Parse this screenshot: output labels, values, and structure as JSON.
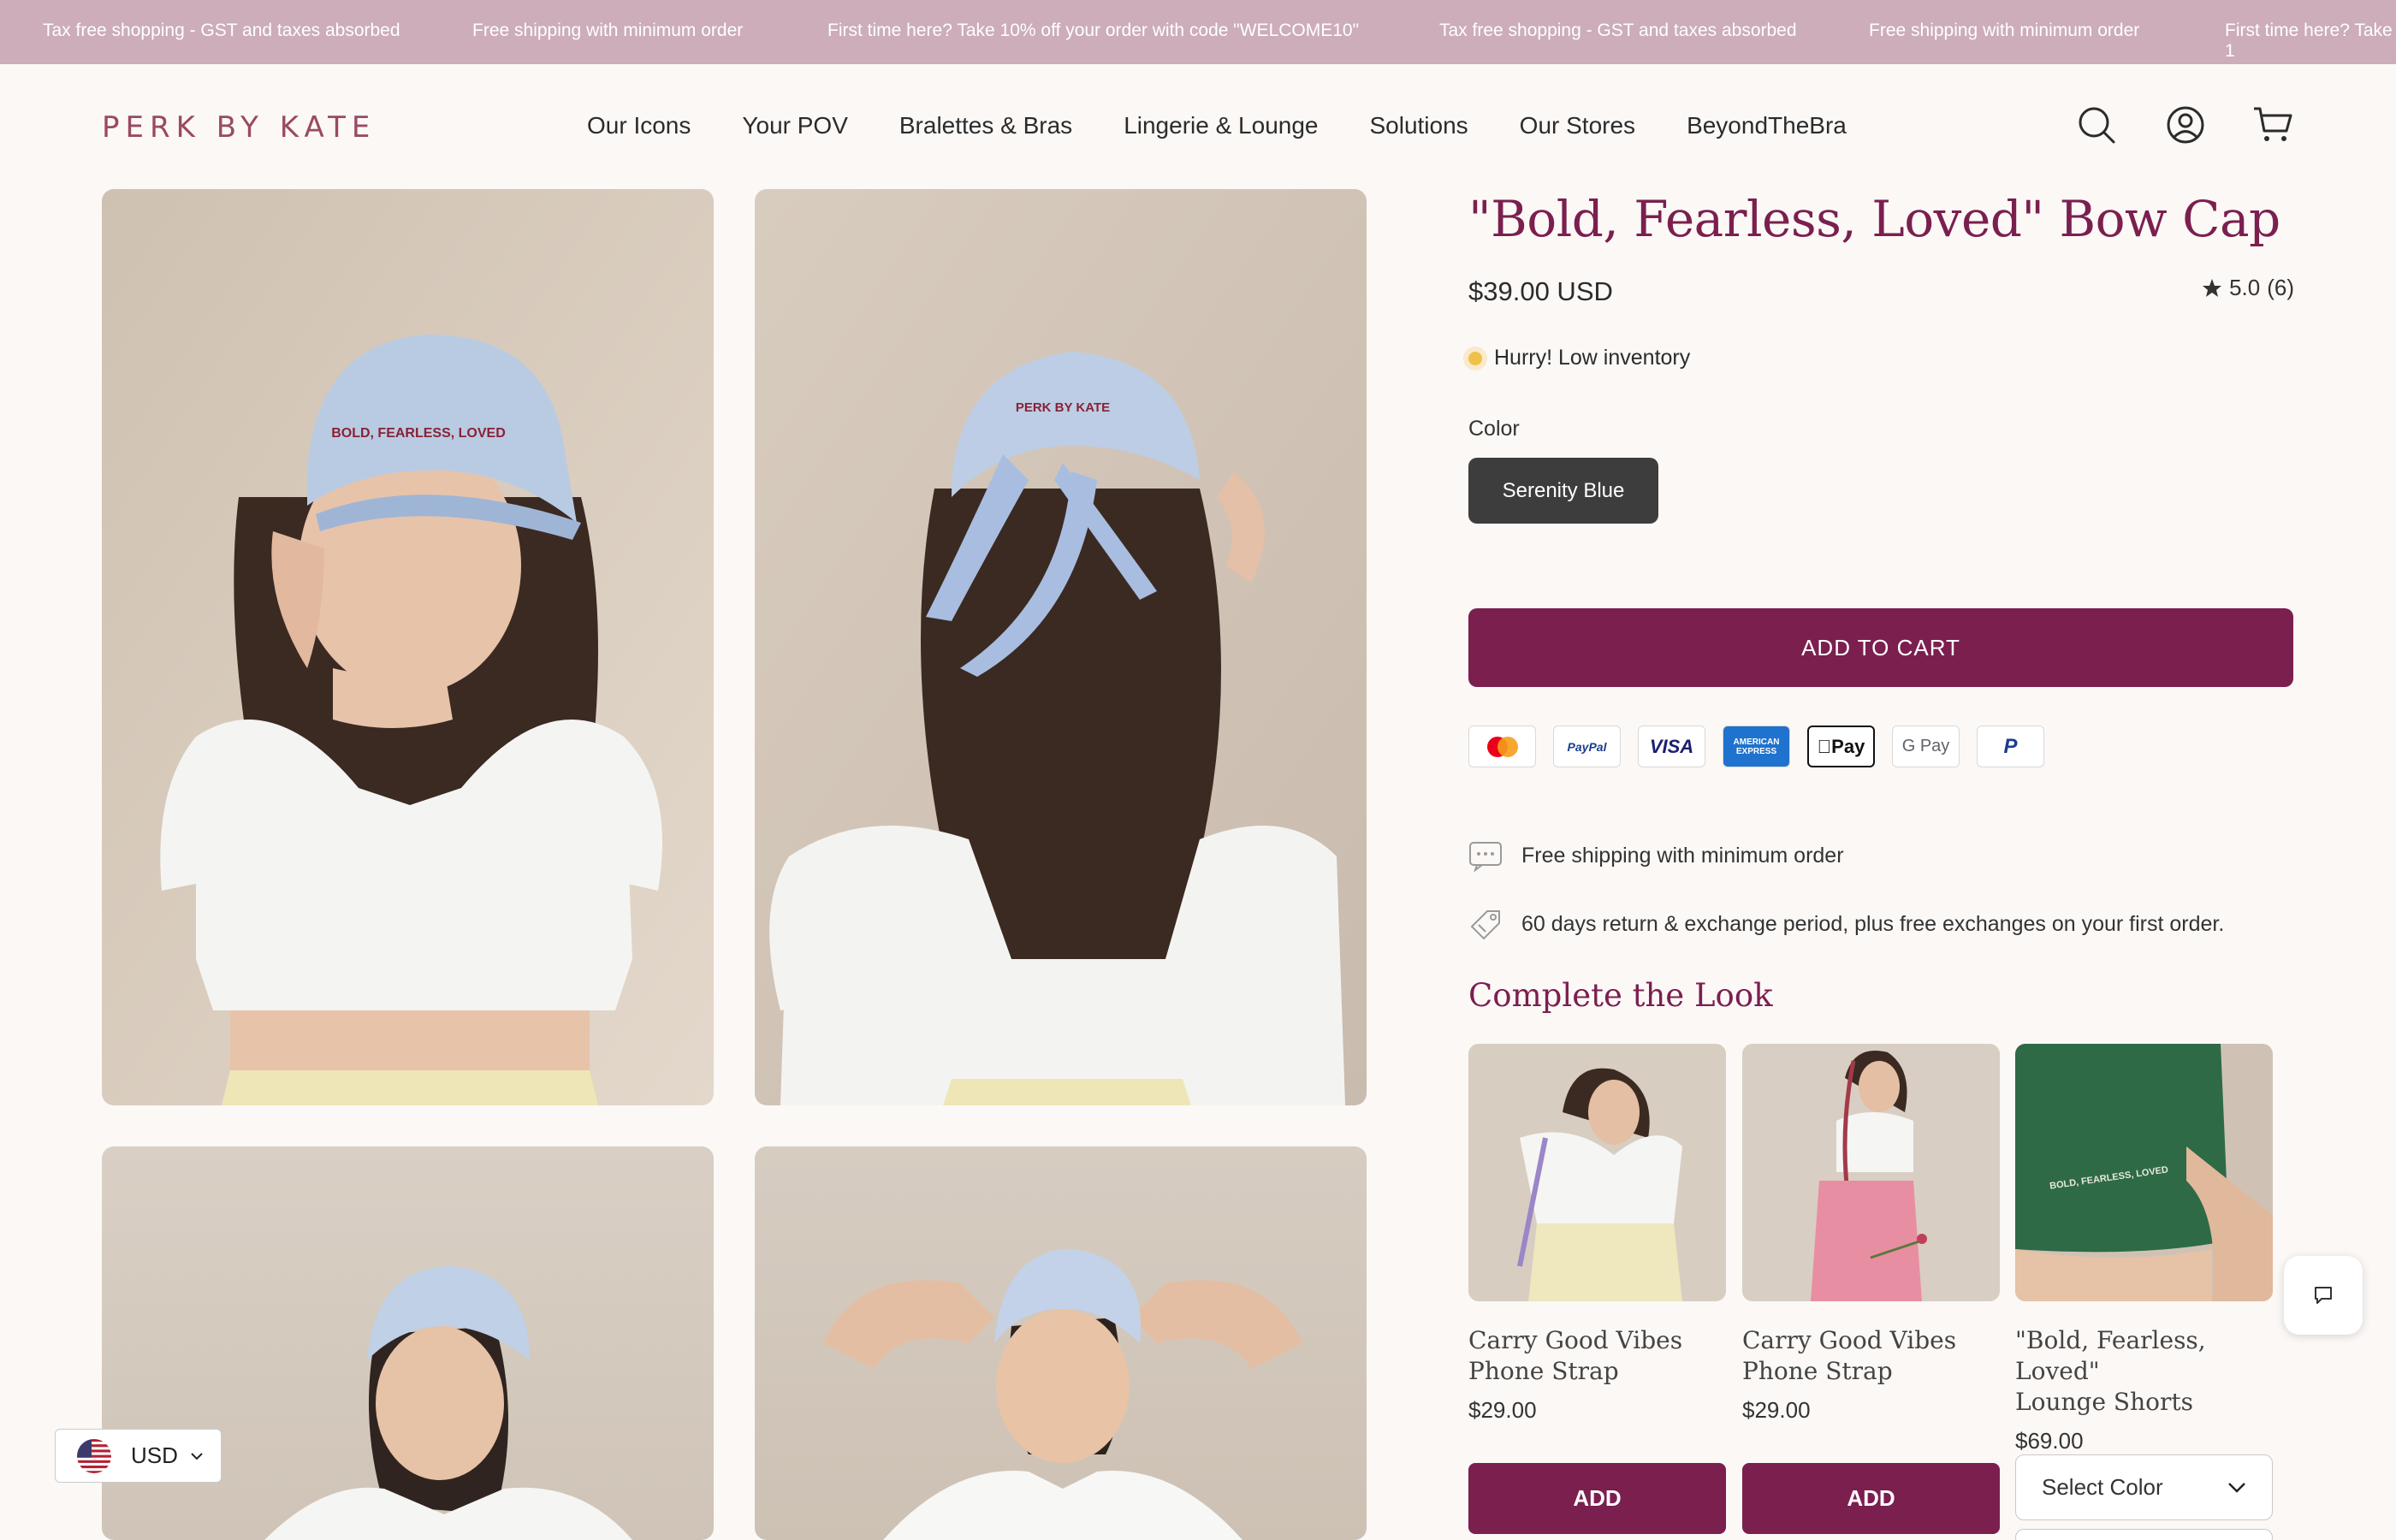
{
  "announcements": [
    "Tax free shopping - GST and taxes absorbed",
    "Free shipping with minimum order",
    "First time here? Take 10% off your order with code \"WELCOME10\"",
    "Tax free shopping - GST and taxes absorbed",
    "Free shipping with minimum order",
    "First time here? Take 1"
  ],
  "header": {
    "logo": "PERK BY KATE",
    "nav": [
      "Our Icons",
      "Your POV",
      "Bralettes & Bras",
      "Lingerie & Lounge",
      "Solutions",
      "Our Stores",
      "BeyondTheBra"
    ],
    "icons": [
      "search-icon",
      "account-icon",
      "cart-icon"
    ]
  },
  "product": {
    "title": "\"Bold, Fearless, Loved\" Bow Cap",
    "price": "$39.00 USD",
    "rating": "5.0",
    "review_count": "(6)",
    "stock_message": "Hurry! Low inventory",
    "color_label": "Color",
    "selected_color": "Serenity Blue",
    "add_to_cart": "ADD TO CART",
    "cap_embroidery_front": "BOLD, FEARLESS, LOVED",
    "cap_embroidery_back": "PERK BY KATE"
  },
  "payments": [
    "mastercard-icon",
    "PayPal",
    "VISA",
    "AMERICAN EXPRESS",
    "Pay",
    "G Pay",
    "P"
  ],
  "perks": [
    {
      "icon": "delivery-icon",
      "text": "Free shipping with minimum order"
    },
    {
      "icon": "return-icon",
      "text": "60 days return & exchange period, plus free exchanges on your first order."
    }
  ],
  "complete_look": {
    "title": "Complete the Look",
    "items": [
      {
        "name_line1": "Carry Good Vibes",
        "name_line2": "Phone Strap",
        "price": "$29.00",
        "action": "ADD"
      },
      {
        "name_line1": "Carry Good Vibes",
        "name_line2": "Phone Strap",
        "price": "$29.00",
        "action": "ADD"
      },
      {
        "name_line1": "\"Bold, Fearless, Loved\"",
        "name_line2": "Lounge Shorts",
        "price": "$69.00",
        "action": "Select Color",
        "shorts_print": "BOLD, FEARLESS, LOVED"
      }
    ]
  },
  "currency": {
    "code": "USD"
  },
  "colors": {
    "brand": "#7b1f4f",
    "announce_bg": "#ccadb9",
    "page_bg": "#fbf8f6",
    "stock_dot": "#f0c04b"
  }
}
